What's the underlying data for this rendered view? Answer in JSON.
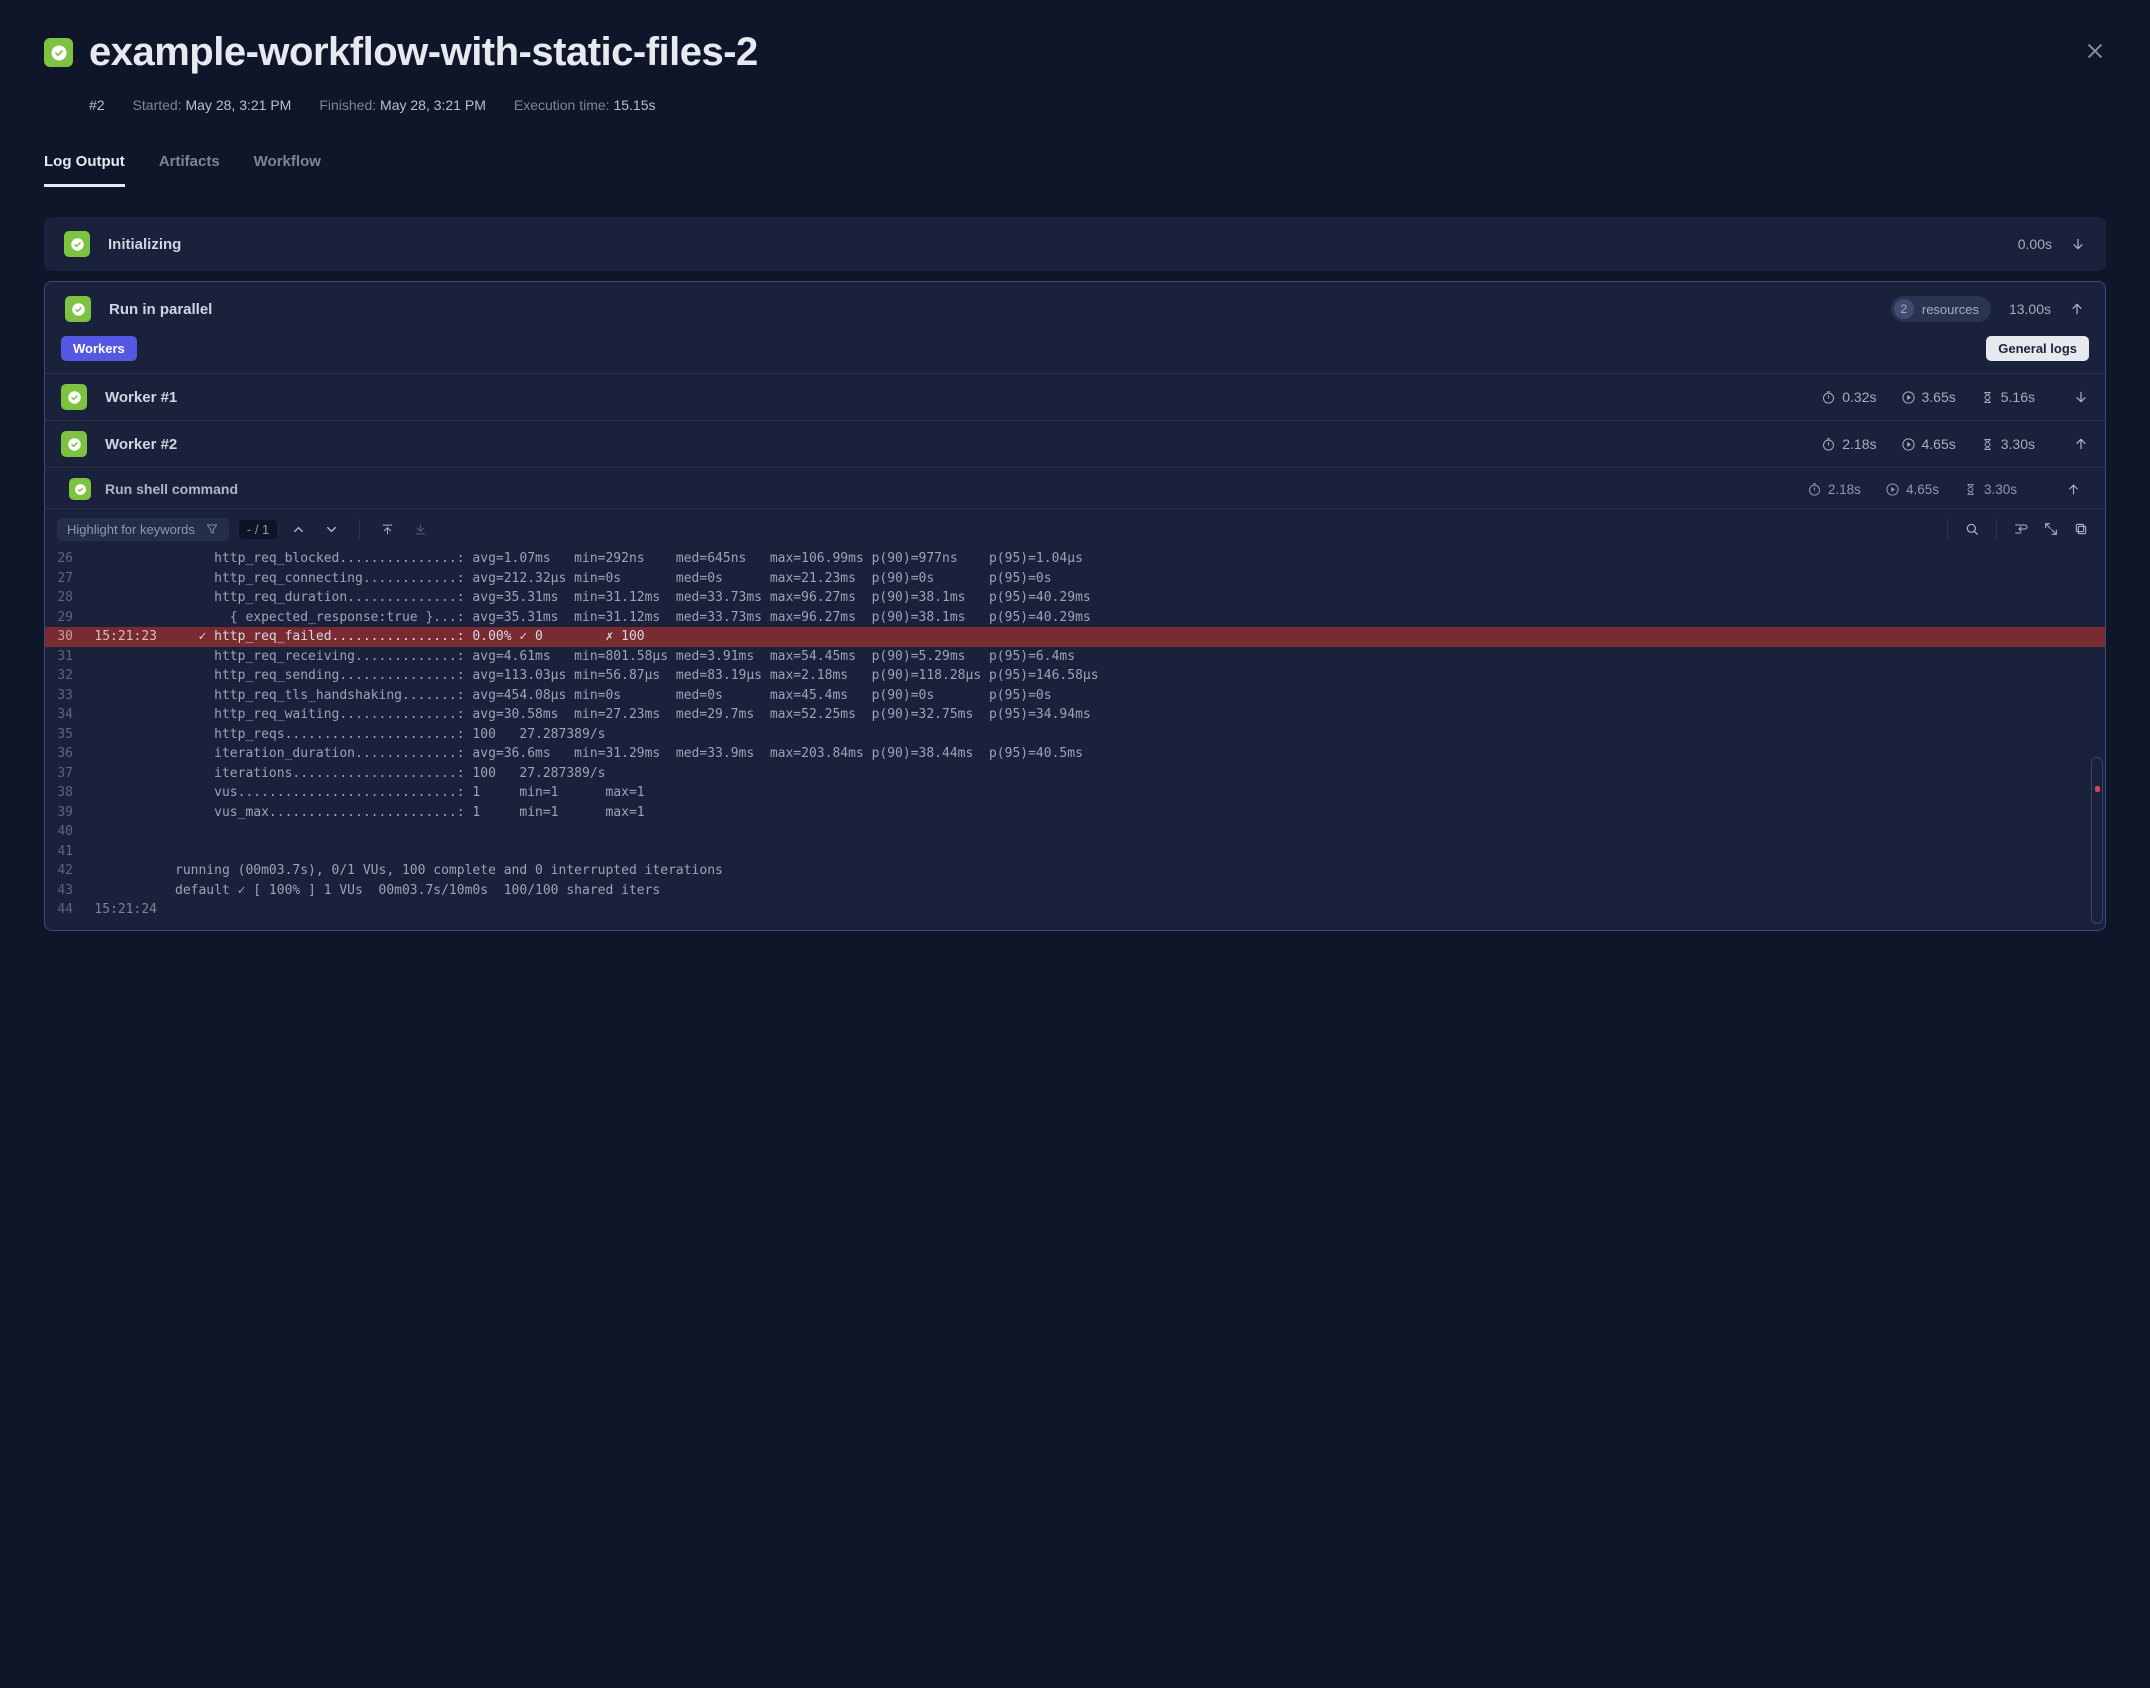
{
  "header": {
    "title": "example-workflow-with-static-files-2",
    "run_num": "#2",
    "started_label": "Started:",
    "started_val": "May 28, 3:21 PM",
    "finished_label": "Finished:",
    "finished_val": "May 28, 3:21 PM",
    "exec_label": "Execution time:",
    "exec_val": "15.15s"
  },
  "tabs": {
    "log": "Log Output",
    "artifacts": "Artifacts",
    "workflow": "Workflow"
  },
  "steps": {
    "init": {
      "title": "Initializing",
      "duration": "0.00s"
    },
    "parallel": {
      "title": "Run in parallel",
      "resources_count": "2",
      "resources_label": "resources",
      "duration": "13.00s",
      "tags": {
        "workers": "Workers",
        "general": "General logs"
      },
      "workers": [
        {
          "title": "Worker #1",
          "m1": "0.32s",
          "m2": "3.65s",
          "m3": "5.16s",
          "expanded": false
        },
        {
          "title": "Worker #2",
          "m1": "2.18s",
          "m2": "4.65s",
          "m3": "3.30s",
          "expanded": true
        }
      ],
      "subtask": {
        "title": "Run shell command",
        "m1": "2.18s",
        "m2": "4.65s",
        "m3": "3.30s"
      }
    }
  },
  "toolbar": {
    "highlight_placeholder": "Highlight for keywords",
    "page": "- / 1"
  },
  "log": [
    {
      "n": "26",
      "ts": "",
      "txt": "     http_req_blocked...............: avg=1.07ms   min=292ns    med=645ns   max=106.99ms p(90)=977ns    p(95)=1.04µs  "
    },
    {
      "n": "27",
      "ts": "",
      "txt": "     http_req_connecting............: avg=212.32µs min=0s       med=0s      max=21.23ms  p(90)=0s       p(95)=0s      "
    },
    {
      "n": "28",
      "ts": "",
      "txt": "     http_req_duration..............: avg=35.31ms  min=31.12ms  med=33.73ms max=96.27ms  p(90)=38.1ms   p(95)=40.29ms "
    },
    {
      "n": "29",
      "ts": "",
      "txt": "       { expected_response:true }...: avg=35.31ms  min=31.12ms  med=33.73ms max=96.27ms  p(90)=38.1ms   p(95)=40.29ms "
    },
    {
      "n": "30",
      "ts": "15:21:23",
      "txt": "   ✓ http_req_failed................: 0.00% ✓ 0        ✗ 100",
      "failed": true
    },
    {
      "n": "31",
      "ts": "",
      "txt": "     http_req_receiving.............: avg=4.61ms   min=801.58µs med=3.91ms  max=54.45ms  p(90)=5.29ms   p(95)=6.4ms   "
    },
    {
      "n": "32",
      "ts": "",
      "txt": "     http_req_sending...............: avg=113.03µs min=56.87µs  med=83.19µs max=2.18ms   p(90)=118.28µs p(95)=146.58µs"
    },
    {
      "n": "33",
      "ts": "",
      "txt": "     http_req_tls_handshaking.......: avg=454.08µs min=0s       med=0s      max=45.4ms   p(90)=0s       p(95)=0s      "
    },
    {
      "n": "34",
      "ts": "",
      "txt": "     http_req_waiting...............: avg=30.58ms  min=27.23ms  med=29.7ms  max=52.25ms  p(90)=32.75ms  p(95)=34.94ms "
    },
    {
      "n": "35",
      "ts": "",
      "txt": "     http_reqs......................: 100   27.287389/s"
    },
    {
      "n": "36",
      "ts": "",
      "txt": "     iteration_duration.............: avg=36.6ms   min=31.29ms  med=33.9ms  max=203.84ms p(90)=38.44ms  p(95)=40.5ms  "
    },
    {
      "n": "37",
      "ts": "",
      "txt": "     iterations.....................: 100   27.287389/s"
    },
    {
      "n": "38",
      "ts": "",
      "txt": "     vus............................: 1     min=1      max=1"
    },
    {
      "n": "39",
      "ts": "",
      "txt": "     vus_max........................: 1     min=1      max=1"
    },
    {
      "n": "40",
      "ts": "",
      "txt": ""
    },
    {
      "n": "41",
      "ts": "",
      "txt": ""
    },
    {
      "n": "42",
      "ts": "",
      "txt": "running (00m03.7s), 0/1 VUs, 100 complete and 0 interrupted iterations"
    },
    {
      "n": "43",
      "ts": "",
      "txt": "default ✓ [ 100% ] 1 VUs  00m03.7s/10m0s  100/100 shared iters"
    },
    {
      "n": "44",
      "ts": "15:21:24",
      "txt": ""
    }
  ]
}
